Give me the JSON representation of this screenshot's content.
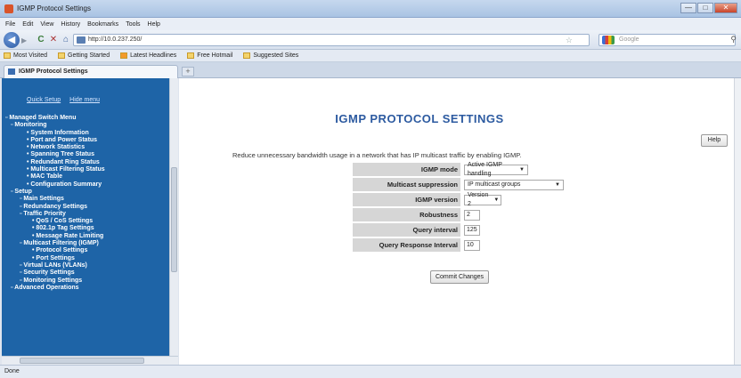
{
  "window": {
    "title": "IGMP Protocol Settings",
    "btn_min": "—",
    "btn_max": "□",
    "btn_close": "✕"
  },
  "menu": [
    "File",
    "Edit",
    "View",
    "History",
    "Bookmarks",
    "Tools",
    "Help"
  ],
  "nav": {
    "url": "http://10.0.237.250/",
    "search_placeholder": "Google",
    "back": "◀",
    "forward": "▶",
    "reload": "C",
    "stop": "✕",
    "home": "⌂"
  },
  "bookmarks": [
    "Most Visited",
    "Getting Started",
    "Latest Headlines",
    "Free Hotmail",
    "Suggested Sites"
  ],
  "tab": {
    "label": "IGMP Protocol Settings"
  },
  "sidebar": {
    "quick_setup": "Quick Setup",
    "hide_menu": "Hide menu",
    "tree": [
      {
        "level": "l0",
        "label": "▫ Managed Switch Menu"
      },
      {
        "level": "l1",
        "label": "▫ Monitoring"
      },
      {
        "level": "l3",
        "label": "• System Information"
      },
      {
        "level": "l3",
        "label": "• Port and Power Status"
      },
      {
        "level": "l3",
        "label": "• Network Statistics"
      },
      {
        "level": "l3",
        "label": "• Spanning Tree Status"
      },
      {
        "level": "l3",
        "label": "• Redundant Ring Status"
      },
      {
        "level": "l3",
        "label": "• Multicast Filtering Status"
      },
      {
        "level": "l3",
        "label": "• MAC Table"
      },
      {
        "level": "l3",
        "label": "• Configuration Summary"
      },
      {
        "level": "l1",
        "label": "▫ Setup"
      },
      {
        "level": "l2",
        "label": "▫ Main Settings"
      },
      {
        "level": "l2",
        "label": "▫ Redundancy Settings"
      },
      {
        "level": "l2",
        "label": "▫ Traffic Priority"
      },
      {
        "level": "l4",
        "label": "• QoS / CoS Settings"
      },
      {
        "level": "l4",
        "label": "• 802.1p Tag Settings"
      },
      {
        "level": "l4",
        "label": "• Message Rate Limiting"
      },
      {
        "level": "l2",
        "label": "▫ Multicast Filtering (IGMP)"
      },
      {
        "level": "l4",
        "label": "• Protocol Settings"
      },
      {
        "level": "l4",
        "label": "• Port Settings"
      },
      {
        "level": "l2",
        "label": "▫ Virtual LANs (VLANs)"
      },
      {
        "level": "l2",
        "label": "▫ Security Settings"
      },
      {
        "level": "l2",
        "label": "▫ Monitoring Settings"
      },
      {
        "level": "l1",
        "label": "▫ Advanced Operations"
      }
    ]
  },
  "main": {
    "title": "IGMP PROTOCOL SETTINGS",
    "help": "Help",
    "description": "Reduce unnecessary bandwidth usage in a network that has IP multicast traffic by enabling IGMP.",
    "fields": [
      {
        "label": "IGMP mode",
        "value": "Active IGMP handling",
        "type": "select"
      },
      {
        "label": "Multicast suppression",
        "value": "IP multicast groups",
        "type": "select"
      },
      {
        "label": "IGMP version",
        "value": "Version 2",
        "type": "select"
      },
      {
        "label": "Robustness",
        "value": "2",
        "type": "input"
      },
      {
        "label": "Query interval",
        "value": "125",
        "type": "input"
      },
      {
        "label": "Query Response Interval",
        "value": "10",
        "type": "input"
      }
    ],
    "commit": "Commit Changes"
  },
  "status": "Done"
}
